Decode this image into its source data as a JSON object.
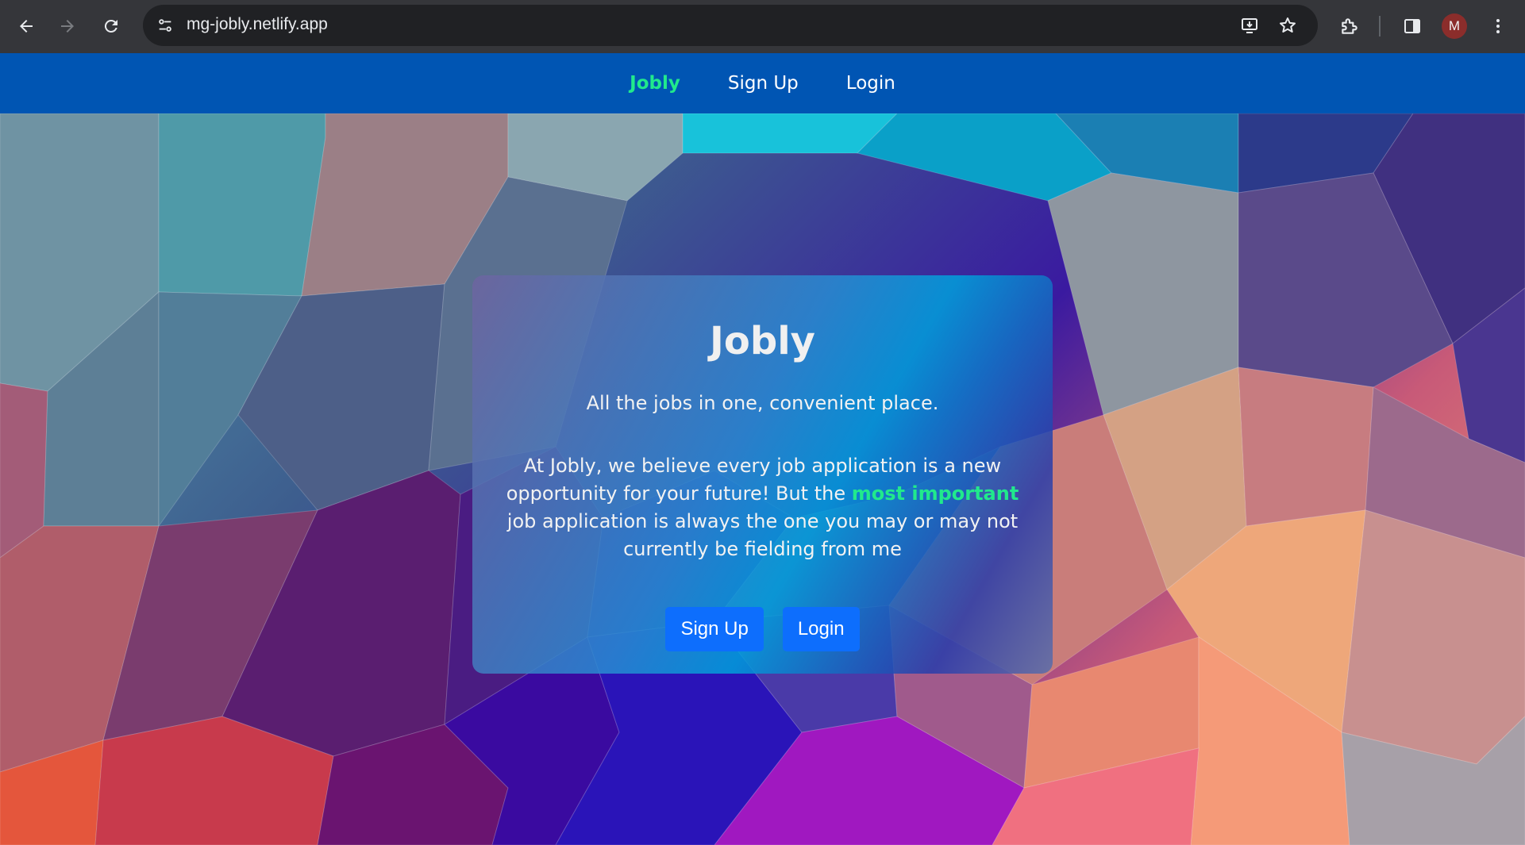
{
  "browser": {
    "url": "mg-jobly.netlify.app",
    "profile_initial": "M",
    "icons": {
      "back": "arrow-left-icon",
      "forward": "arrow-right-icon",
      "reload": "reload-icon",
      "site_info": "tune-icon",
      "install": "install-app-icon",
      "bookmark": "star-icon",
      "extensions": "puzzle-icon",
      "side_panel": "side-panel-icon",
      "menu": "kebab-menu-icon"
    }
  },
  "navbar": {
    "brand": "Jobly",
    "items": [
      {
        "label": "Sign Up"
      },
      {
        "label": "Login"
      }
    ],
    "background": "#0055b3",
    "brand_color": "#21e98c"
  },
  "card": {
    "title": "Jobly",
    "tagline": "All the jobs in one, convenient place.",
    "blurb_before": "At Jobly, we believe every job application is a new opportunity for your future! But the ",
    "blurb_highlight": "most important",
    "blurb_after": " job application is always the one you may or may not currently be fielding from me",
    "buttons": {
      "signup": "Sign Up",
      "login": "Login"
    },
    "button_color": "#0d6efd",
    "highlight_color": "#21e98c"
  }
}
